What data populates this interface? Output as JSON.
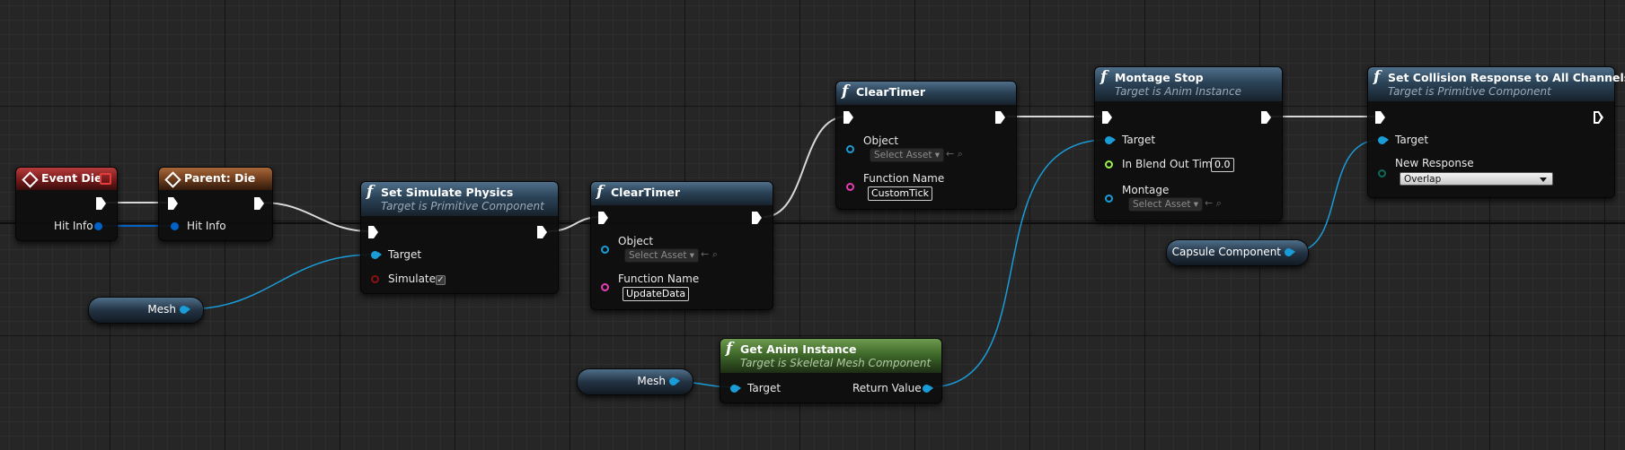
{
  "colors": {
    "exec": "#ffffff",
    "object": "#1a9cd8",
    "struct": "#0062c6",
    "bool": "#8b1010",
    "float": "#9af24a",
    "delegate": "#e83cb5",
    "enum": "#0a6b5b",
    "wire_exec": "#d9d9d9"
  },
  "nodes": {
    "event_die": {
      "title": "Event Die",
      "pins": {
        "hit_info": "Hit Info"
      }
    },
    "parent_die": {
      "title": "Parent: Die",
      "pins": {
        "hit_info": "Hit Info"
      }
    },
    "set_simulate": {
      "title": "Set Simulate Physics",
      "subtitle": "Target is Primitive Component",
      "pins": {
        "target": "Target",
        "simulate": "Simulate",
        "simulate_checked": "✓"
      }
    },
    "clear_timer_1": {
      "title": "ClearTimer",
      "pins": {
        "object": "Object",
        "select_asset": "Select Asset",
        "function_name": "Function Name",
        "function_value": "UpdateData"
      }
    },
    "clear_timer_2": {
      "title": "ClearTimer",
      "pins": {
        "object": "Object",
        "select_asset": "Select Asset",
        "function_name": "Function Name",
        "function_value": "CustomTick"
      }
    },
    "get_anim": {
      "title": "Get Anim Instance",
      "subtitle": "Target is Skeletal Mesh Component",
      "pins": {
        "target": "Target",
        "return_value": "Return Value"
      }
    },
    "montage_stop": {
      "title": "Montage Stop",
      "subtitle": "Target is Anim Instance",
      "pins": {
        "target": "Target",
        "blend_out": "In Blend Out Time",
        "blend_value": "0.0",
        "montage": "Montage",
        "select_asset": "Select Asset"
      }
    },
    "set_collision": {
      "title": "Set Collision Response to All Channels",
      "subtitle": "Target is Primitive Component",
      "pins": {
        "target": "Target",
        "new_response": "New Response",
        "response_value": "Overlap"
      }
    }
  },
  "variables": {
    "mesh_1": "Mesh",
    "mesh_2": "Mesh",
    "capsule": "Capsule Component"
  },
  "icons": {
    "function": "f",
    "event": "event-diamond-icon",
    "asset_use": "←",
    "asset_browse": "⌕"
  }
}
